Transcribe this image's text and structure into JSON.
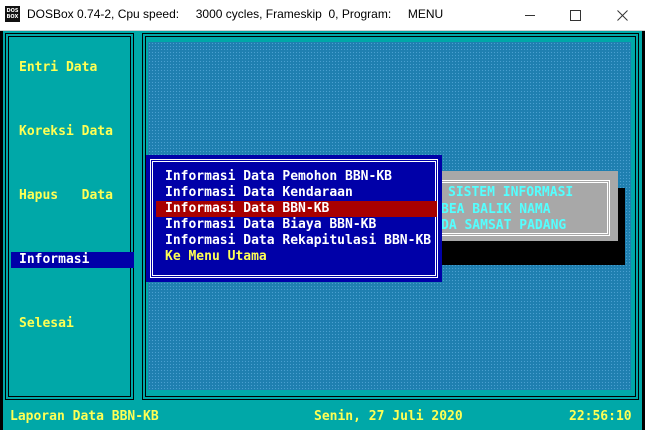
{
  "window": {
    "title": "DOSBox 0.74-2, Cpu speed:     3000 cycles, Frameskip  0, Program:     MENU",
    "icon_label": "DOS BOX",
    "controls": [
      "minimize",
      "maximize",
      "close"
    ]
  },
  "colors": {
    "cyan_bg": "#00a8a8",
    "menu_text": "#ffff54",
    "active_bg": "#0000a8",
    "selected_bg": "#a80000",
    "info_text": "#54ffff",
    "info_box": "#a8a8a8"
  },
  "main_menu": {
    "items": [
      {
        "label": "Entri Data",
        "active": false
      },
      {
        "label": "Koreksi Data",
        "active": false
      },
      {
        "label": "Hapus   Data",
        "active": false
      },
      {
        "label": "Informasi",
        "active": true
      },
      {
        "label": "Selesai",
        "active": false
      }
    ]
  },
  "info_box": {
    "lines": [
      "SISTEM INFORMASI",
      "BEA BALIK NAMA",
      "DA SAMSAT PADANG"
    ]
  },
  "submenu": {
    "items": [
      {
        "label": "Informasi Data Pemohon BBN-KB",
        "selected": false
      },
      {
        "label": "Informasi Data Kendaraan",
        "selected": false
      },
      {
        "label": "Informasi Data BBN-KB",
        "selected": true
      },
      {
        "label": "Informasi Data Biaya BBN-KB",
        "selected": false
      },
      {
        "label": "Informasi Data Rekapitulasi BBN-KB",
        "selected": false
      },
      {
        "label": "Ke Menu Utama",
        "selected": false
      }
    ]
  },
  "status": {
    "left": "Laporan Data BBN-KB",
    "date": "Senin, 27 Juli 2020",
    "time": "22:56:10"
  }
}
